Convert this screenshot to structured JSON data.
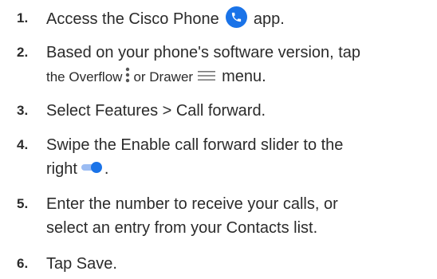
{
  "steps": [
    {
      "number": "1.",
      "text_before": "Access the Cisco Phone",
      "icon": "phone-app-icon",
      "text_after": "app."
    },
    {
      "number": "2.",
      "line1": "Based on your phone's software version, tap",
      "line2_prefix": "the Overflow",
      "icon_a": "overflow-menu-icon",
      "line2_mid": "or Drawer",
      "icon_b": "drawer-menu-icon",
      "line2_suffix": "menu."
    },
    {
      "number": "3.",
      "text": "Select Features > Call forward."
    },
    {
      "number": "4.",
      "line1": "Swipe the Enable call forward slider to the",
      "line2": "right",
      "icon": "toggle-on-icon",
      "line2_suffix": "."
    },
    {
      "number": "5.",
      "line1": "Enter the number to receive your calls, or",
      "line2": "select an entry from your Contacts list."
    },
    {
      "number": "6.",
      "text": "Tap Save."
    }
  ],
  "colors": {
    "text": "#2b2b2b",
    "accent": "#1a73e8",
    "icon_gray": "#555555",
    "toggle_track": "#9bbcf3"
  }
}
